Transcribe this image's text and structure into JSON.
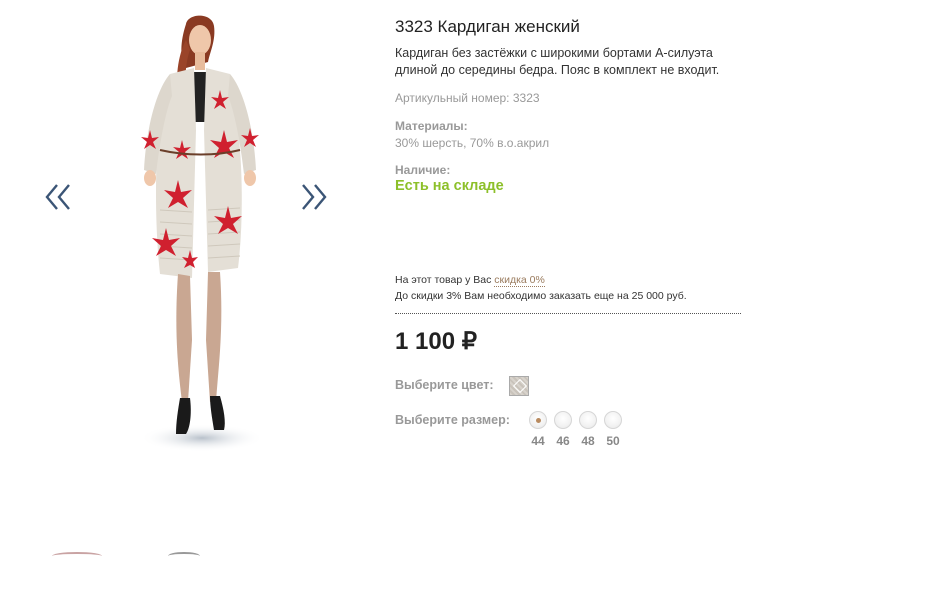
{
  "gallery": {
    "prev_icon": "double-chevron-left-icon",
    "next_icon": "double-chevron-right-icon"
  },
  "product": {
    "title": "3323 Кардиган женский",
    "description": "Кардиган без застёжки с широкими бортами А-силуэта длиной до середины бедра. Пояс в комплект не входит.",
    "sku": "Артикульный номер: 3323",
    "materials_label": "Материалы:",
    "materials_value": "30% шерсть, 70% в.о.акрил",
    "availability_label": "Наличие:",
    "availability_value": "Есть на складе",
    "discount_prefix": "На этот товар у Вас",
    "discount_link": "скидка 0%",
    "discount_note": "До скидки 3% Вам необходимо заказать еще на 25 000 руб.",
    "price": "1 100 ₽",
    "color_label": "Выберите цвет:",
    "size_label": "Выберите размер:",
    "sizes": [
      "44",
      "46",
      "48",
      "50"
    ],
    "selected_size": "44"
  },
  "colors": {
    "availability": "#8dc02a",
    "muted_text": "#999999",
    "link": "#9a7b5e",
    "arrow": "#3b5576",
    "pattern_red": "#d0202f"
  }
}
